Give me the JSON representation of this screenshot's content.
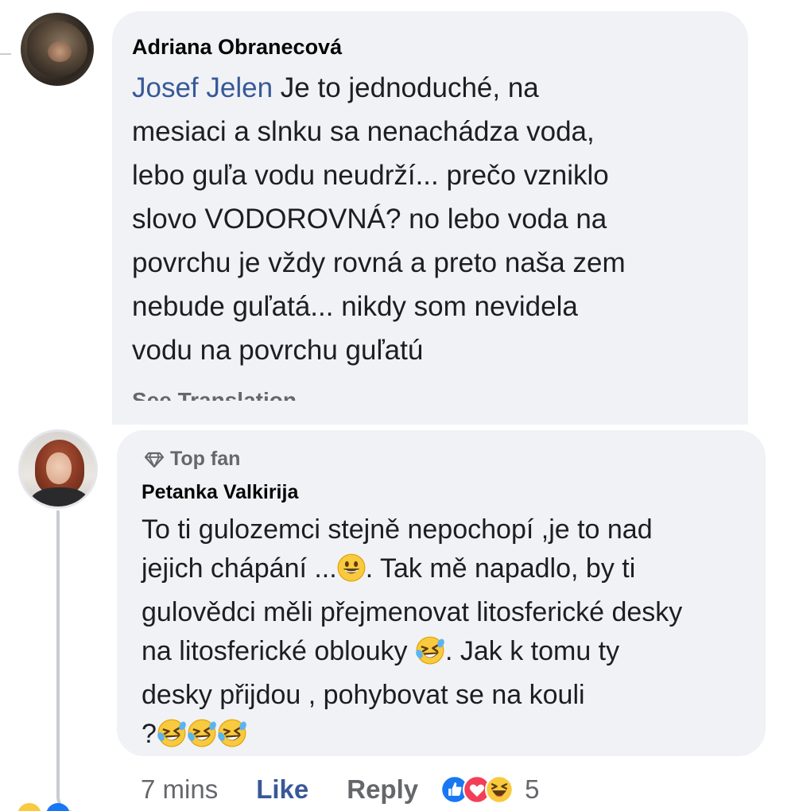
{
  "comment_1": {
    "author": "Adriana Obranecová",
    "mention": "Josef Jelen",
    "body_lines": [
      " Je to jednoduché, na",
      "mesiaci a slnku sa nenachádza voda,",
      "lebo guľa vodu neudrží... prečo vzniklo",
      "slovo VODOROVNÁ? no lebo voda na",
      "povrchu je vždy rovná a preto naša zem",
      "nebude guľatá...  nikdy som nevidela",
      "vodu na povrchu guľatú"
    ],
    "see_translation": "See Translation"
  },
  "comment_2": {
    "badge": "Top fan",
    "author": "Petanka Valkirija",
    "line_1": "To ti gulozemci stejně nepochopí ,je to nad",
    "line_2a": "jejich chápání ...",
    "line_2b": ". Tak mě napadlo,  by ti",
    "line_3": "gulovědci měli přejmenovat litosferické desky",
    "line_4a": "na litosferické oblouky ",
    "line_4b": ". Jak k tomu ty",
    "line_5": "desky přijdou , pohybovat se na kouli",
    "line_6": "?",
    "actions": {
      "time": "7 mins",
      "like": "Like",
      "reply": "Reply",
      "reaction_count": "5"
    }
  },
  "icons": [
    "diamond-icon",
    "grinning-emoji",
    "rofl-emoji",
    "like-reaction-icon",
    "love-reaction-icon",
    "haha-reaction-icon"
  ],
  "colors": {
    "bubble": "#f0f2f5",
    "link": "#385898",
    "secondary_text": "#65676b",
    "like_blue": "#1877f2",
    "love_red": "#f33e58",
    "emoji_yellow": "#fcd34d"
  }
}
